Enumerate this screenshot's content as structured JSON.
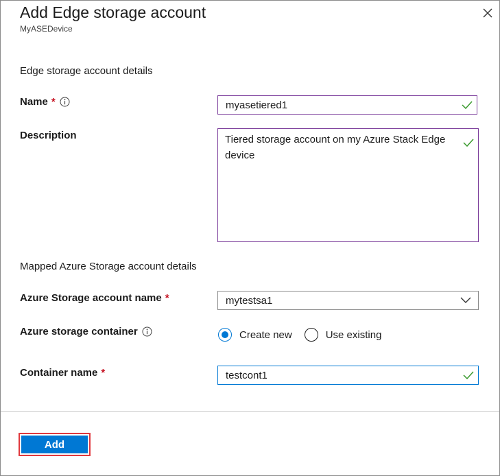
{
  "blade": {
    "title": "Add Edge storage account",
    "subtitle": "MyASEDevice"
  },
  "edge_section": {
    "heading": "Edge storage account details",
    "name_label": "Name",
    "name_required": "*",
    "name_value": "myasetiered1",
    "description_label": "Description",
    "description_value": "Tiered storage account on my Azure Stack Edge device"
  },
  "azure_section": {
    "heading": "Mapped Azure Storage account details",
    "account_label": "Azure Storage account name",
    "account_required": "*",
    "account_selected": "mytestsa1",
    "container_label": "Azure storage container",
    "container_options": [
      "Create new",
      "Use existing"
    ],
    "container_selected": "Create new",
    "container_name_label": "Container name",
    "container_name_required": "*",
    "container_name_value": "testcont1"
  },
  "footer": {
    "add_label": "Add"
  },
  "colors": {
    "accent": "#0078d4",
    "valid_check": "#3a9a2e",
    "required": "#c50f1f",
    "focus_border": "#7a3b9a",
    "highlight": "#e0393e"
  },
  "icons": {
    "close": "close-icon",
    "info": "info-icon",
    "valid": "checkmark-icon",
    "dropdown": "chevron-down-icon"
  }
}
